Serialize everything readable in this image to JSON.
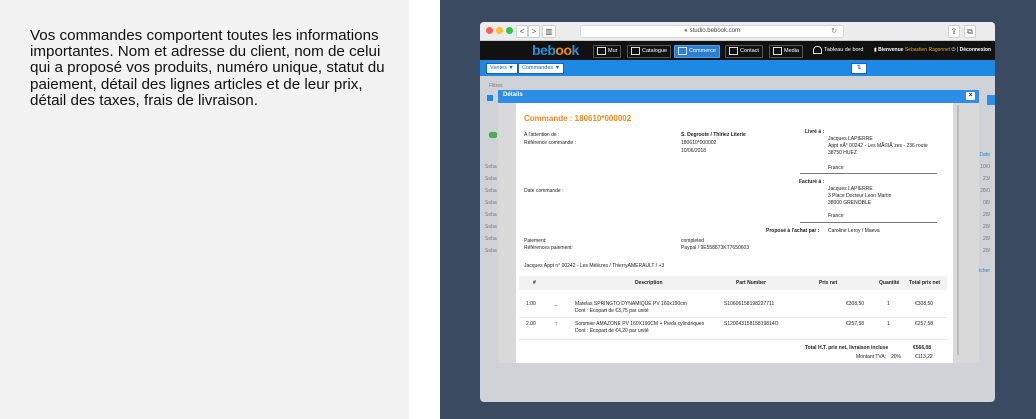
{
  "description": "Vos commandes comportent toutes les informations importantes. Nom et adresse du client, nom de celui qui a proposé vos produits, numéro unique, statut du paiement, détail des lignes articles et de leur prix, détail des taxes, frais de livraison.",
  "browser": {
    "url": "studio.bebook.com",
    "nav_back": "<",
    "nav_forward": ">",
    "sidebar_glyph": "▥",
    "reload_glyph": "↻",
    "share_glyph": "⇪",
    "tabs_glyph": "⧉",
    "colors": {
      "close": "#ff5f57",
      "minimize": "#febc2e",
      "maximize": "#28c840"
    }
  },
  "app": {
    "logo_first": "be",
    "logo_o1": "b",
    "logo_o2": "oo",
    "logo_last": "k",
    "nav": [
      {
        "label": "Mur",
        "icon": "wall-icon"
      },
      {
        "label": "Catalogue",
        "icon": "catalog-icon"
      },
      {
        "label": "Commerce",
        "icon": "commerce-icon",
        "active": true
      },
      {
        "label": "Contact",
        "icon": "contact-icon"
      },
      {
        "label": "Media",
        "icon": "media-icon"
      },
      {
        "label": "Tableau de bord",
        "icon": "dashboard-icon"
      }
    ],
    "user_prefix": "Bienvenue",
    "user_name": "Sebastien Ragonnet",
    "separator": "|",
    "logout": "Déconnexion",
    "accent": "#1e88e5"
  },
  "subbar": {
    "ventes": "Ventes ▼",
    "commandes": "Commandes ▼",
    "icon_glyph": "⇅"
  },
  "background": {
    "filters_label": "Filtres",
    "header_right": "Date",
    "rows": [
      {
        "left": "Seba",
        "right": "10/0"
      },
      {
        "left": "Seba",
        "right": "23/"
      },
      {
        "left": "Seba",
        "right": "28/0"
      },
      {
        "left": "Seba",
        "right": "08/"
      },
      {
        "left": "Seba",
        "right": "28/"
      },
      {
        "left": "Seba",
        "right": "28/"
      },
      {
        "left": "Seba",
        "right": "28/"
      },
      {
        "left": "Seba",
        "right": "28/"
      }
    ],
    "more_right": "Afficher"
  },
  "modal": {
    "title": "Détails",
    "close": "×",
    "order_title": "Commande : 180610*000002",
    "attention_label": "A l'attention de :",
    "reference_label": "Référence commande :",
    "customer_name": "S. Degroote / Thiriez Literie",
    "reference_value": "180610*000002",
    "order_date_value": "10/06/2018",
    "date_commande_label": "Date commande :",
    "delivered_label": "Livré à :",
    "delivered": [
      "Jacques LAPIERRE",
      "Appt nÂ° 00242 - Les MÃ©lÃ¨zes - 236 route",
      "38750 HUEZ",
      "France"
    ],
    "billed_label": "Facturé à :",
    "billed": [
      "Jacques LAPIERRE",
      "3 Place Docteur Leon Martin",
      "38000 GRENOBLE",
      "France"
    ],
    "proposed_label": "Proposé à l'achat par :",
    "proposed_value": "Caroline Leroy / Maeva",
    "payment_label": "Paiement:",
    "payment_value": "completed",
    "payment_refs_label": "Références paiement:",
    "payment_refs_value": "Paypal / 9E558873KT7650603",
    "address_line": "Jacques Appt n° 00242 - Les Mélèzes / ThierryAMERAULT / +3",
    "table": {
      "headers": [
        "#",
        "Description",
        "Part Number",
        "Prix net",
        "Quantité",
        "Total prix net"
      ],
      "rows": [
        {
          "num": "1.00",
          "desc": "Matelas SPRINGTO DYNAMIQUE PV 160x190cm",
          "desc2": "Dont : Ecopart de €3,75 par unité",
          "part": "S10606158198227711",
          "price": "€308,50",
          "qty": "1",
          "total": "€308,50"
        },
        {
          "num": "2.00",
          "desc": "Sommier AMAZONE PV 160X190CM + Pieds cylindriques",
          "desc2": "Dont : Ecopart de €4,20 par unité",
          "part": "S12004315815819814O",
          "price": "€257,58",
          "qty": "1",
          "total": "€257,58"
        }
      ]
    },
    "total_label": "Total H.T. prix net, livraison incluse",
    "total_value": "€566,08",
    "vat_label": "Montant TVA:",
    "vat_rate": "20%",
    "vat_value": "€113,22"
  }
}
